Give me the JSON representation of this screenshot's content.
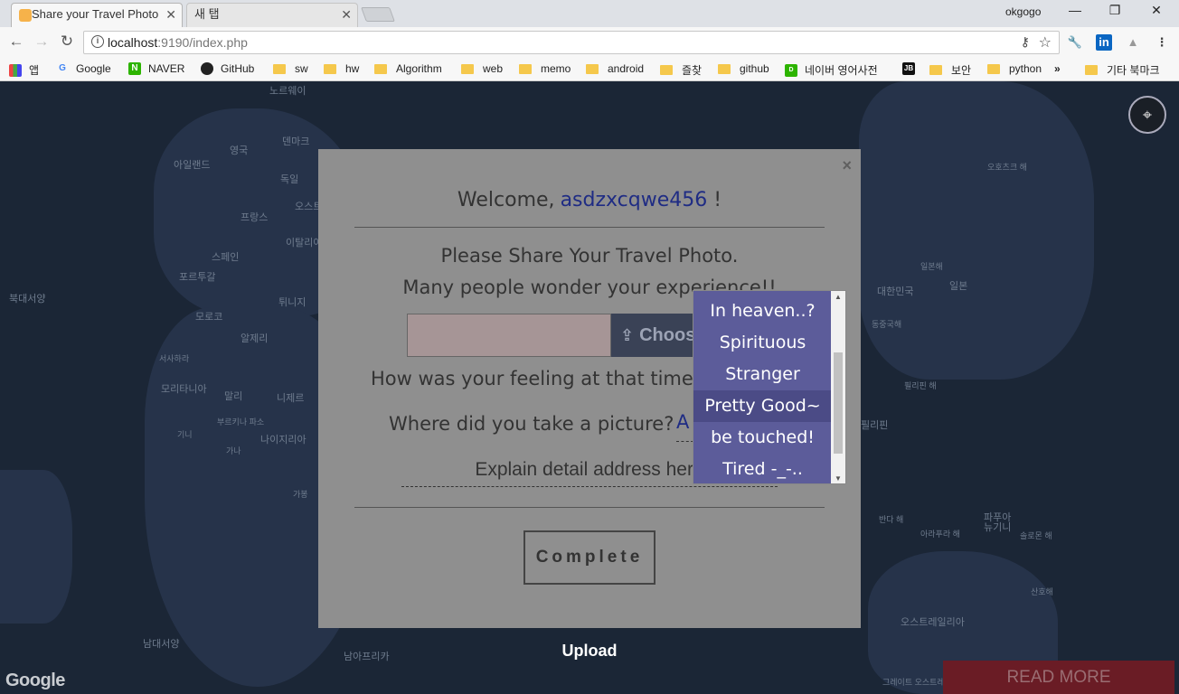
{
  "browser": {
    "tabs": [
      {
        "title": "Share your Travel Photo",
        "active": true
      },
      {
        "title": "새 탭",
        "active": false
      }
    ],
    "profile_name": "okgogo",
    "window_controls": {
      "minimize": "—",
      "restore": "❐",
      "close": "✕"
    },
    "url_host": "localhost",
    "url_rest": ":9190/index.php",
    "nav": {
      "back": "←",
      "forward": "→",
      "reload": "↻"
    },
    "bookmarks": [
      {
        "label": "앱",
        "icon": "apps-grid"
      },
      {
        "label": "Google",
        "icon": "google-g"
      },
      {
        "label": "NAVER",
        "icon": "naver-n"
      },
      {
        "label": "GitHub",
        "icon": "github-cat"
      },
      {
        "label": "sw",
        "icon": "folder"
      },
      {
        "label": "hw",
        "icon": "folder"
      },
      {
        "label": "Algorithm",
        "icon": "folder"
      },
      {
        "label": "web",
        "icon": "folder"
      },
      {
        "label": "memo",
        "icon": "folder"
      },
      {
        "label": "android",
        "icon": "folder"
      },
      {
        "label": "즐찾",
        "icon": "folder"
      },
      {
        "label": "github",
        "icon": "folder"
      },
      {
        "label": "네이버 영어사전",
        "icon": "dict"
      },
      {
        "label": "보안",
        "icon": "folder"
      },
      {
        "label": "python",
        "icon": "folder"
      }
    ],
    "bookmarks_more": "»",
    "other_bookmarks": "기타 북마크"
  },
  "map": {
    "labels": [
      "노르웨이",
      "영국",
      "덴마크",
      "아일랜드",
      "독일",
      "오스트리",
      "프랑스",
      "이탈리아",
      "스페인",
      "포르투갈",
      "튀니지",
      "모로코",
      "알제리",
      "서사하라",
      "모리타니아",
      "말리",
      "니제르",
      "부르키나 파소",
      "기니",
      "가나",
      "나이지리아",
      "가봉",
      "북대서양",
      "남대서양",
      "남아프리카",
      "오호츠크 해",
      "일본해",
      "대한민국",
      "일본",
      "동중국해",
      "필리핀 해",
      "필리핀",
      "반다 해",
      "아라푸라 해",
      "파푸아 뉴기니",
      "솔로몬 해",
      "산호해",
      "오스트레일리아",
      "그레이트 오스트레일리아"
    ],
    "attribution": "Google"
  },
  "modal": {
    "close": "×",
    "welcome_prefix": "Welcome,",
    "username": "asdzxcqwe456",
    "welcome_suffix": "!",
    "intro_line1": "Please Share Your Travel Photo.",
    "intro_line2": "Many people wonder your experience!!",
    "choose_label": "Choose",
    "feeling_question": "How was your feeling at that time?",
    "place_question": "Where did you take a picture?",
    "place_value": "A",
    "detail_placeholder": "Explain detail address here",
    "complete_label": "Complete"
  },
  "feeling_dropdown": {
    "options": [
      "In heaven..?",
      "Spirituous",
      "Stranger",
      "Pretty Good~",
      "be touched!",
      "Tired -_-.."
    ],
    "highlighted": "Pretty Good~"
  },
  "upload_label": "Upload",
  "read_more_label": "READ MORE",
  "colors": {
    "username": "#1f2c84",
    "dropdown_bg": "#5c5c9a",
    "read_more_bg": "#6a1c25",
    "modal_bg": "#8f8f8f"
  }
}
